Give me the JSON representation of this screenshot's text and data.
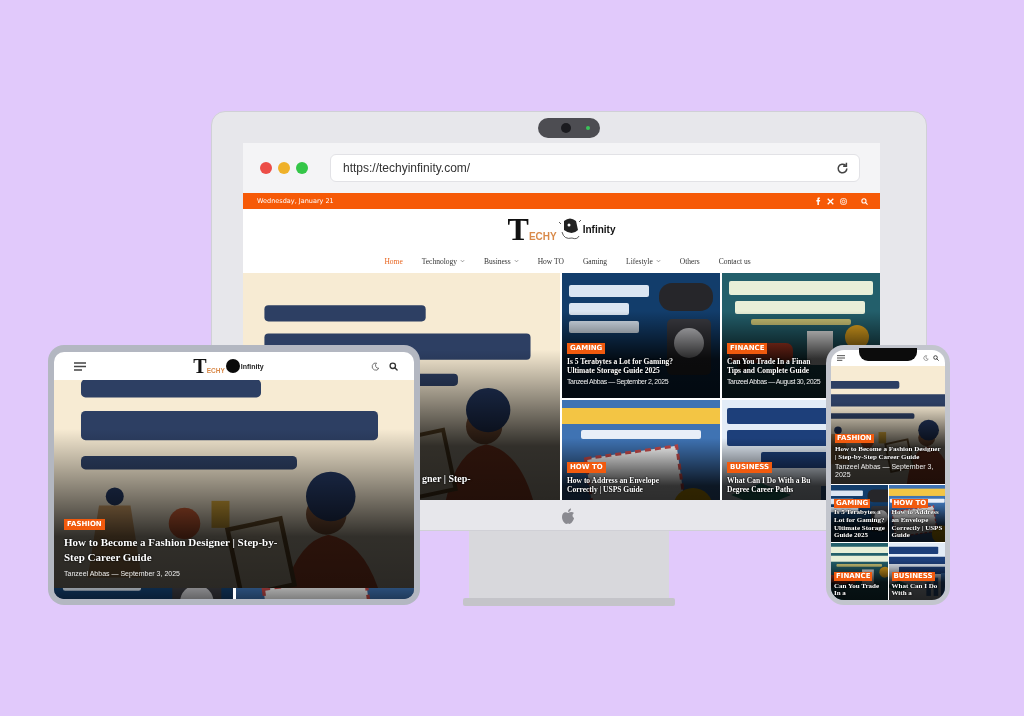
{
  "monitor": {
    "browser": {
      "url": "https://techyinfinity.com/"
    },
    "site": {
      "date": "Wednesday, January 21",
      "logo": {
        "wordmark": "TECHY",
        "suffix": "Infinity"
      },
      "nav": [
        {
          "label": "Home",
          "selected": true,
          "dropdown": false
        },
        {
          "label": "Technology",
          "selected": false,
          "dropdown": true
        },
        {
          "label": "Business",
          "selected": false,
          "dropdown": true
        },
        {
          "label": "How TO",
          "selected": false,
          "dropdown": false
        },
        {
          "label": "Gaming",
          "selected": false,
          "dropdown": false
        },
        {
          "label": "Lifestyle",
          "selected": false,
          "dropdown": true
        },
        {
          "label": "Others",
          "selected": false,
          "dropdown": false
        },
        {
          "label": "Contact us",
          "selected": false,
          "dropdown": false
        }
      ],
      "featured": {
        "title": "gner | Step-"
      },
      "cards": [
        {
          "category": "GAMING",
          "title": "Is 5 Terabytes a Lot for Gaming?\nUltimate Storage Guide 2025",
          "meta": "Tanzeel Abbas — September 2, 2025"
        },
        {
          "category": "FINANCE",
          "title": "Can You Trade In a Finan\nTips and Complete Guide",
          "meta": "Tanzeel Abbas — August 30, 2025"
        },
        {
          "category": "HOW TO",
          "title": "How to Address an Envelope\nCorrectly | USPS Guide"
        },
        {
          "category": "BUSINESS",
          "title": "What Can I Do With a Bu\nDegree Career Paths"
        }
      ]
    }
  },
  "tablet": {
    "logo": {
      "wordmark": "TECHY",
      "suffix": "Infinity"
    },
    "featured": {
      "category": "FASHION",
      "title": "How to Become a Fashion Designer | Step-by-\nStep Career Guide",
      "meta": "Tanzeel Abbas — September 3, 2025"
    }
  },
  "phone": {
    "featured": {
      "category": "FASHION",
      "title": "How to Become a Fashion Designer | Step-by-Step Career Guide",
      "meta": "Tanzeel Abbas — September 3, 2025"
    },
    "cards": [
      {
        "category": "GAMING",
        "title": "Is 5 Terabytes a Lot for Gaming? Ultimate Storage Guide 2025"
      },
      {
        "category": "HOW TO",
        "title": "How to Address an Envelope Correctly | USPS Guide"
      },
      {
        "category": "FINANCE",
        "title": "Can You Trade In a"
      },
      {
        "category": "BUSINESS",
        "title": "What Can I Do With a"
      }
    ]
  }
}
